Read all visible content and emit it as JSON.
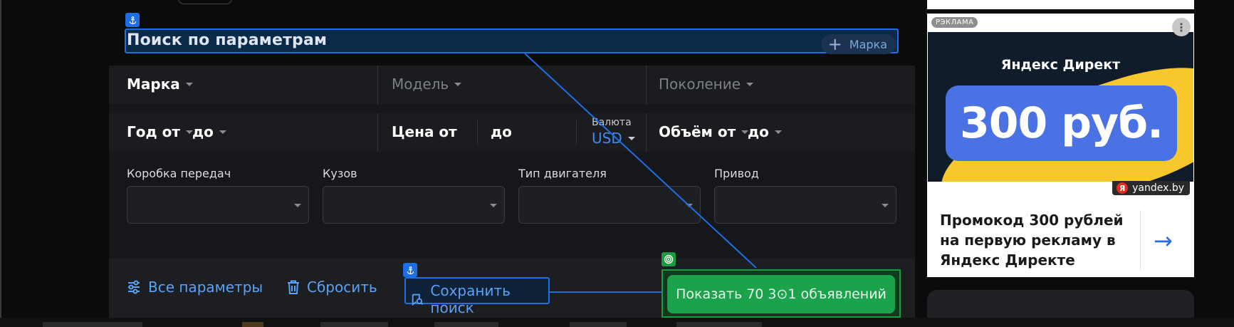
{
  "search": {
    "title": "Поиск по параметрам",
    "add_brand_label": "Марка",
    "brand": "Марка",
    "model": "Модель",
    "generation": "Поколение",
    "year_from": "Год от",
    "year_to": "до",
    "price_from": "Цена от",
    "price_to": "до",
    "currency_caption": "Валюта",
    "currency": "USD",
    "volume_from": "Объём от",
    "volume_to": "до",
    "fields": {
      "gearbox": "Коробка передач",
      "body": "Кузов",
      "engine": "Тип двигателя",
      "drive": "Привод"
    },
    "actions": {
      "all_params": "Все параметры",
      "reset": "Сбросить",
      "save_search": "Сохранить поиск",
      "show_results": "Показать 70 3⊙1 объявлений"
    }
  },
  "ad": {
    "tag": "РЭКЛАМА",
    "brand_line": "Яндекс Директ",
    "headline": "300 руб.",
    "domain": "yandex.by",
    "domain_logo": "Я",
    "text": "Промокод 300 рублей на первую рекламу в Яндекс Директе"
  },
  "colors": {
    "accent": "#1e6ee6",
    "success": "#1aa34a",
    "link": "#5aa2f5",
    "ad_yellow": "#f7c72c",
    "ad_blue": "#4a72e4"
  },
  "icons": {
    "anchor": "anchor-icon",
    "target": "target-icon",
    "plus": "plus-icon",
    "settings": "sliders-icon",
    "trash": "trash-icon",
    "save": "bookmark-search-icon",
    "arrow": "arrow-right-icon"
  }
}
